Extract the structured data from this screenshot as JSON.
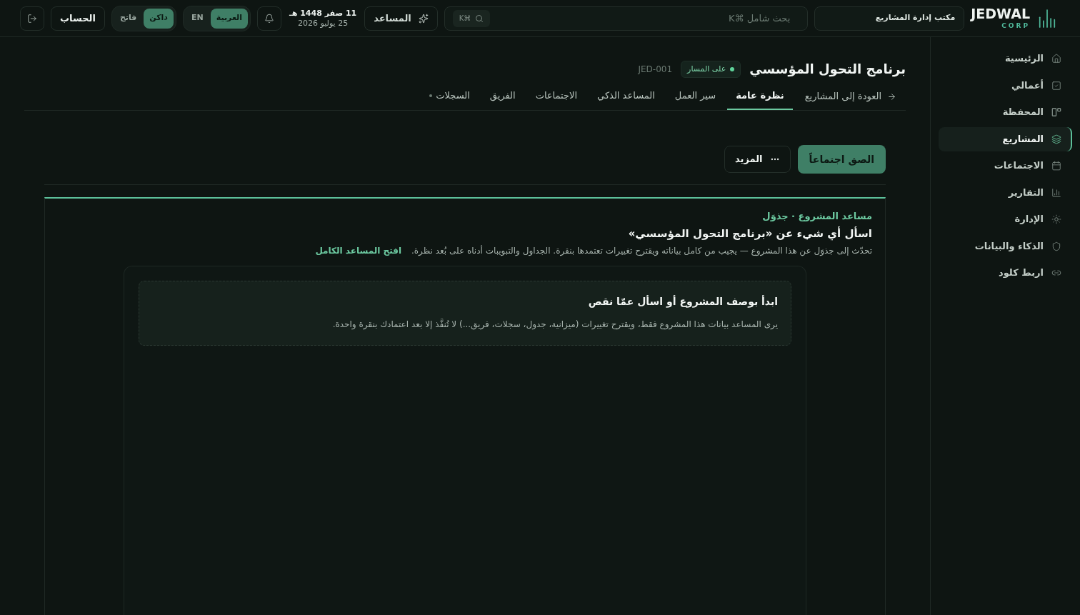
{
  "topbar": {
    "logo": {
      "name": "JEDWAL",
      "sub": "CORP"
    },
    "office": "مكتب إدارة المشاريع",
    "search": {
      "placeholder": "بحث شامل ⌘K",
      "shortcut": "⌘K"
    },
    "assistant_button": "المساعد",
    "date": {
      "hijri": "11 صفر 1448 هـ",
      "gregorian": "25 يوليو 2026"
    },
    "language": [
      {
        "label": "العربية",
        "selected": true
      },
      {
        "label": "EN",
        "selected": false
      }
    ],
    "theme": [
      {
        "label": "داكن",
        "selected": true
      },
      {
        "label": "فاتح",
        "selected": false
      }
    ],
    "account_button": "الحساب"
  },
  "sidebar": {
    "items": [
      {
        "label": "الرئيسية",
        "selected": false
      },
      {
        "label": "أعمالي",
        "selected": false
      },
      {
        "label": "المحفظة",
        "selected": false
      },
      {
        "label": "المشاريع",
        "selected": true
      },
      {
        "label": "الاجتماعات",
        "selected": false
      },
      {
        "label": "التقارير",
        "selected": false
      },
      {
        "label": "الإدارة",
        "selected": false
      },
      {
        "label": "الذكاء والبيانات",
        "selected": false
      },
      {
        "label": "اربط كلود",
        "selected": false
      }
    ]
  },
  "project": {
    "title": "برنامج التحول المؤسسي",
    "status": "على المسار",
    "code": "JED-001"
  },
  "tabs": {
    "back": "العودة إلى المشاريع",
    "items": [
      {
        "label": "نظرة عامة",
        "selected": true,
        "indicator": false
      },
      {
        "label": "سير العمل",
        "selected": false,
        "indicator": false
      },
      {
        "label": "المساعد الذكي",
        "selected": false,
        "indicator": false
      },
      {
        "label": "الاجتماعات",
        "selected": false,
        "indicator": false
      },
      {
        "label": "الفريق",
        "selected": false,
        "indicator": false
      },
      {
        "label": "السجلات",
        "selected": false,
        "indicator": true
      }
    ]
  },
  "actions": [
    {
      "label": "الصق اجتماعاً",
      "kind": "primary"
    },
    {
      "label": "المزيد",
      "kind": "more"
    }
  ],
  "assistant_panel": {
    "eyebrow": "مساعد المشروع · جذوَل",
    "heading": "اسأل أي شيء عن «برنامج التحول المؤسسي»",
    "description": "تحدّث إلى جذوَل عن هذا المشروع — يجيب من كامل بياناته ويقترح تغييرات تعتمدها بنقرة. الجداول والتبويبات أدناه على بُعد نظرة.",
    "link": "افتح المساعد الكامل",
    "empty_state": {
      "title": "ابدأ بوصف المشروع أو اسأل عمّا نقص",
      "text": "يرى المساعد بيانات هذا المشروع فقط، ويقترح تغييرات (ميزانية، جدول، سجلات، فريق...) لا تُنفَّذ إلا بعد اعتمادك بنقرة واحدة."
    }
  }
}
